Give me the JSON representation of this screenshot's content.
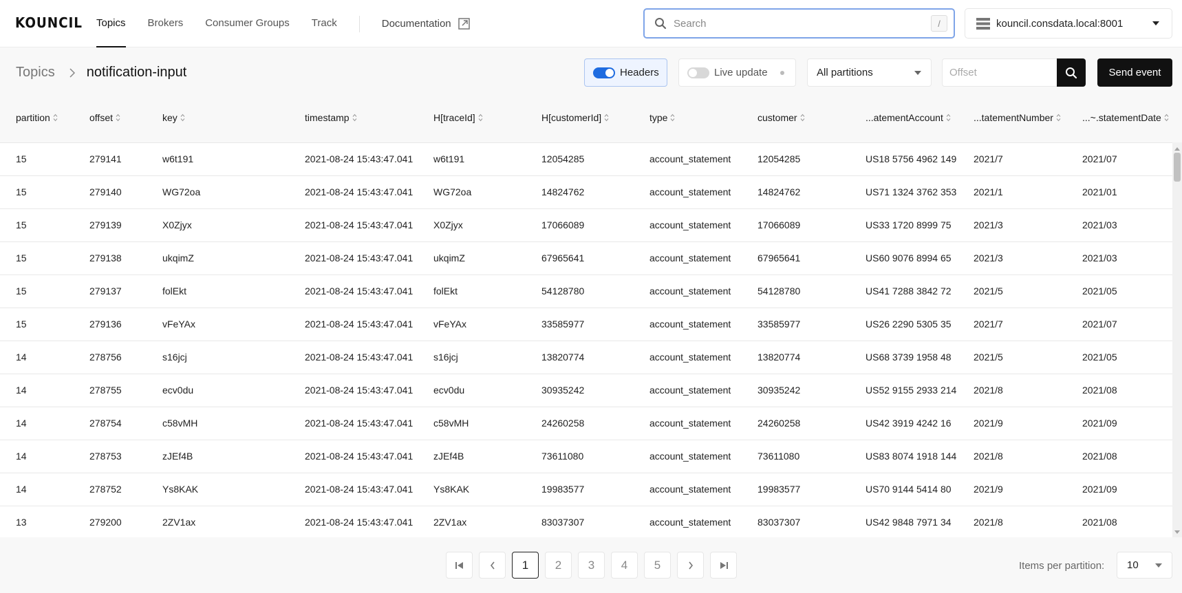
{
  "app": {
    "logo": "KOUNCIL"
  },
  "nav": {
    "items": [
      {
        "label": "Topics",
        "active": true
      },
      {
        "label": "Brokers",
        "active": false
      },
      {
        "label": "Consumer Groups",
        "active": false
      },
      {
        "label": "Track",
        "active": false
      }
    ],
    "documentation": {
      "label": "Documentation",
      "icon": "external-link-icon"
    }
  },
  "search": {
    "placeholder": "Search",
    "value": "",
    "shortcut": "/",
    "icon": "search-icon"
  },
  "server": {
    "label": "kouncil.consdata.local:8001",
    "icon": "server-icon"
  },
  "breadcrumb": {
    "root": "Topics",
    "current": "notification-input"
  },
  "toolbar": {
    "headers": {
      "label": "Headers",
      "enabled": true
    },
    "live_update": {
      "label": "Live update",
      "enabled": false
    },
    "partitions": {
      "selected": "All partitions"
    },
    "offset": {
      "placeholder": "Offset",
      "value": ""
    },
    "send_event": "Send event"
  },
  "table": {
    "columns": [
      "partition",
      "offset",
      "key",
      "timestamp",
      "H[traceId]",
      "H[customerId]",
      "type",
      "customer",
      "...atementAccount",
      "...tatementNumber",
      "...~.statementDate"
    ],
    "rows": [
      [
        "15",
        "279141",
        "w6t191",
        "2021-08-24 15:43:47.041",
        "w6t191",
        "12054285",
        "account_statement",
        "12054285",
        "US18 5756 4962 149",
        "2021/7",
        "2021/07"
      ],
      [
        "15",
        "279140",
        "WG72oa",
        "2021-08-24 15:43:47.041",
        "WG72oa",
        "14824762",
        "account_statement",
        "14824762",
        "US71 1324 3762 353",
        "2021/1",
        "2021/01"
      ],
      [
        "15",
        "279139",
        "X0Zjyx",
        "2021-08-24 15:43:47.041",
        "X0Zjyx",
        "17066089",
        "account_statement",
        "17066089",
        "US33 1720 8999 75",
        "2021/3",
        "2021/03"
      ],
      [
        "15",
        "279138",
        "ukqimZ",
        "2021-08-24 15:43:47.041",
        "ukqimZ",
        "67965641",
        "account_statement",
        "67965641",
        "US60 9076 8994 65",
        "2021/3",
        "2021/03"
      ],
      [
        "15",
        "279137",
        "folEkt",
        "2021-08-24 15:43:47.041",
        "folEkt",
        "54128780",
        "account_statement",
        "54128780",
        "US41 7288 3842 72",
        "2021/5",
        "2021/05"
      ],
      [
        "15",
        "279136",
        "vFeYAx",
        "2021-08-24 15:43:47.041",
        "vFeYAx",
        "33585977",
        "account_statement",
        "33585977",
        "US26 2290 5305 35",
        "2021/7",
        "2021/07"
      ],
      [
        "14",
        "278756",
        "s16jcj",
        "2021-08-24 15:43:47.041",
        "s16jcj",
        "13820774",
        "account_statement",
        "13820774",
        "US68 3739 1958 48",
        "2021/5",
        "2021/05"
      ],
      [
        "14",
        "278755",
        "ecv0du",
        "2021-08-24 15:43:47.041",
        "ecv0du",
        "30935242",
        "account_statement",
        "30935242",
        "US52 9155 2933 214",
        "2021/8",
        "2021/08"
      ],
      [
        "14",
        "278754",
        "c58vMH",
        "2021-08-24 15:43:47.041",
        "c58vMH",
        "24260258",
        "account_statement",
        "24260258",
        "US42 3919 4242 16",
        "2021/9",
        "2021/09"
      ],
      [
        "14",
        "278753",
        "zJEf4B",
        "2021-08-24 15:43:47.041",
        "zJEf4B",
        "73611080",
        "account_statement",
        "73611080",
        "US83 8074 1918 144",
        "2021/8",
        "2021/08"
      ],
      [
        "14",
        "278752",
        "Ys8KAK",
        "2021-08-24 15:43:47.041",
        "Ys8KAK",
        "19983577",
        "account_statement",
        "19983577",
        "US70 9144 5414 80",
        "2021/9",
        "2021/09"
      ],
      [
        "13",
        "279200",
        "2ZV1ax",
        "2021-08-24 15:43:47.041",
        "2ZV1ax",
        "83037307",
        "account_statement",
        "83037307",
        "US42 9848 7971 34",
        "2021/8",
        "2021/08"
      ]
    ]
  },
  "pagination": {
    "pages": [
      "1",
      "2",
      "3",
      "4",
      "5"
    ],
    "current_page": "1",
    "items_per_partition_label": "Items per partition:",
    "items_per_partition": "10"
  },
  "colors": {
    "accent": "#1f6ce0",
    "primary_button": "#111111",
    "focus_border": "#7ea4e8"
  }
}
